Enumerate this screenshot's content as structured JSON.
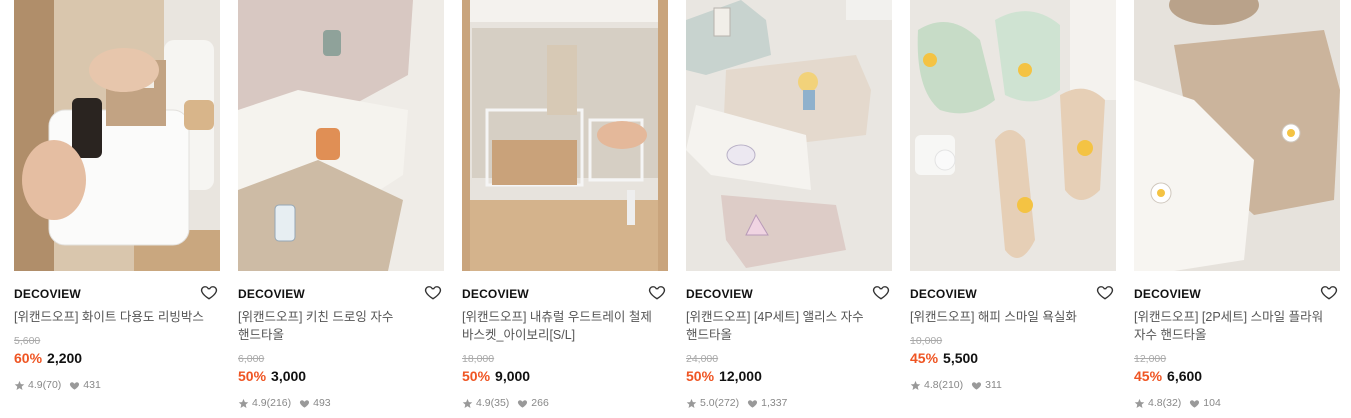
{
  "products": [
    {
      "brand": "DECOVIEW",
      "title": "[위캔드오프] 화이트 다용도 리빙박스",
      "original_price": "5,600",
      "discount": "60%",
      "price": "2,200",
      "rating": "4.9",
      "reviews": "(70)",
      "likes": "431",
      "image_icon": "storage-box-photo"
    },
    {
      "brand": "DECOVIEW",
      "title": "[위캔드오프] 키친 드로잉 자수 핸드타올",
      "original_price": "6,000",
      "discount": "50%",
      "price": "3,000",
      "rating": "4.9",
      "reviews": "(216)",
      "likes": "493",
      "image_icon": "kitchen-towel-photo"
    },
    {
      "brand": "DECOVIEW",
      "title": "[위캔드오프] 내츄럴 우드트레이 철제 바스켓_아이보리[S/L]",
      "original_price": "18,000",
      "discount": "50%",
      "price": "9,000",
      "rating": "4.9",
      "reviews": "(35)",
      "likes": "266",
      "image_icon": "wire-basket-photo"
    },
    {
      "brand": "DECOVIEW",
      "title": "[위캔드오프] [4P세트] 앨리스 자수 핸드타올",
      "original_price": "24,000",
      "discount": "50%",
      "price": "12,000",
      "rating": "5.0",
      "reviews": "(272)",
      "likes": "1,337",
      "image_icon": "alice-towel-photo"
    },
    {
      "brand": "DECOVIEW",
      "title": "[위캔드오프] 해피 스마일 욕실화",
      "original_price": "10,000",
      "discount": "45%",
      "price": "5,500",
      "rating": "4.8",
      "reviews": "(210)",
      "likes": "311",
      "image_icon": "bath-slipper-photo"
    },
    {
      "brand": "DECOVIEW",
      "title": "[위캔드오프] [2P세트] 스마일 플라워 자수 핸드타올",
      "original_price": "12,000",
      "discount": "45%",
      "price": "6,600",
      "rating": "4.8",
      "reviews": "(32)",
      "likes": "104",
      "image_icon": "flower-towel-photo"
    }
  ],
  "colors": {
    "discount": "#ef5523",
    "muted": "#888888"
  }
}
